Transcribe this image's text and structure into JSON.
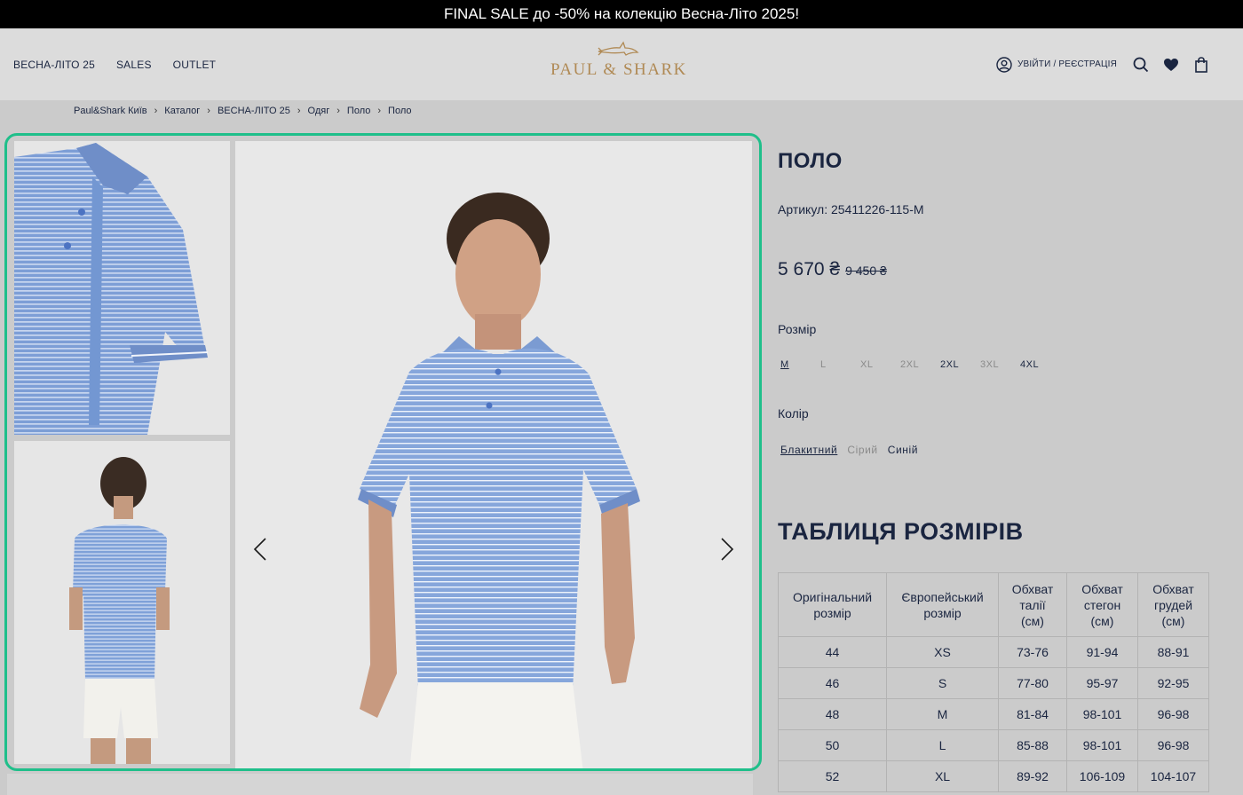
{
  "promo": {
    "text": "FINAL SALE до -50% на колекцію Весна-Літо 2025!"
  },
  "header": {
    "nav": [
      {
        "label": "ВЕСНА-ЛІТО 25"
      },
      {
        "label": "SALES"
      },
      {
        "label": "OUTLET"
      }
    ],
    "logo_text": "PAUL & SHARK",
    "login_label": "УВІЙТИ / РЕЄСТРАЦІЯ",
    "icons": [
      "user-icon",
      "search-icon",
      "heart-icon",
      "bag-icon"
    ]
  },
  "breadcrumb": [
    "Paul&Shark Київ",
    "Каталог",
    "ВЕСНА-ЛІТО 25",
    "Одяг",
    "Поло",
    "Поло"
  ],
  "product": {
    "title": "ПОЛО",
    "sku": "Артикул: 25411226-115-M",
    "price": "5 670 ₴",
    "old_price": "9 450 ₴",
    "size_label": "Розмір",
    "sizes": [
      {
        "label": "M",
        "state": "selected"
      },
      {
        "label": "L",
        "state": "unavailable"
      },
      {
        "label": "XL",
        "state": "unavailable"
      },
      {
        "label": "2XL",
        "state": "unavailable"
      },
      {
        "label": "2XL",
        "state": "available"
      },
      {
        "label": "3XL",
        "state": "unavailable"
      },
      {
        "label": "4XL",
        "state": "available"
      }
    ],
    "color_label": "Колір",
    "colors": [
      {
        "label": "Блакитний",
        "state": "selected"
      },
      {
        "label": "Сірий",
        "state": "unavailable"
      },
      {
        "label": "Синій",
        "state": "available"
      }
    ]
  },
  "size_table": {
    "title": "ТАБЛИЦЯ РОЗМІРІВ",
    "headers": [
      [
        "Оригінальний",
        "розмір"
      ],
      [
        "Європейський",
        "розмір"
      ],
      [
        "Обхват",
        "талії",
        "(см)"
      ],
      [
        "Обхват",
        "стегон",
        "(см)"
      ],
      [
        "Обхват",
        "грудей",
        "(см)"
      ]
    ],
    "rows": [
      [
        "44",
        "XS",
        "73-76",
        "91-94",
        "88-91"
      ],
      [
        "46",
        "S",
        "77-80",
        "95-97",
        "92-95"
      ],
      [
        "48",
        "M",
        "81-84",
        "98-101",
        "96-98"
      ],
      [
        "50",
        "L",
        "85-88",
        "98-101",
        "96-98"
      ],
      [
        "52",
        "XL",
        "89-92",
        "106-109",
        "104-107"
      ]
    ]
  },
  "colors_theme": {
    "promo_bg": "#000000",
    "header_bg": "#dcdcdc",
    "page_bg": "#cbcbcb",
    "text": "#1a2540",
    "logo_gold": "#b08a55",
    "highlight_border": "#1fbf8a",
    "polo_blue": "#7d9ed6"
  }
}
